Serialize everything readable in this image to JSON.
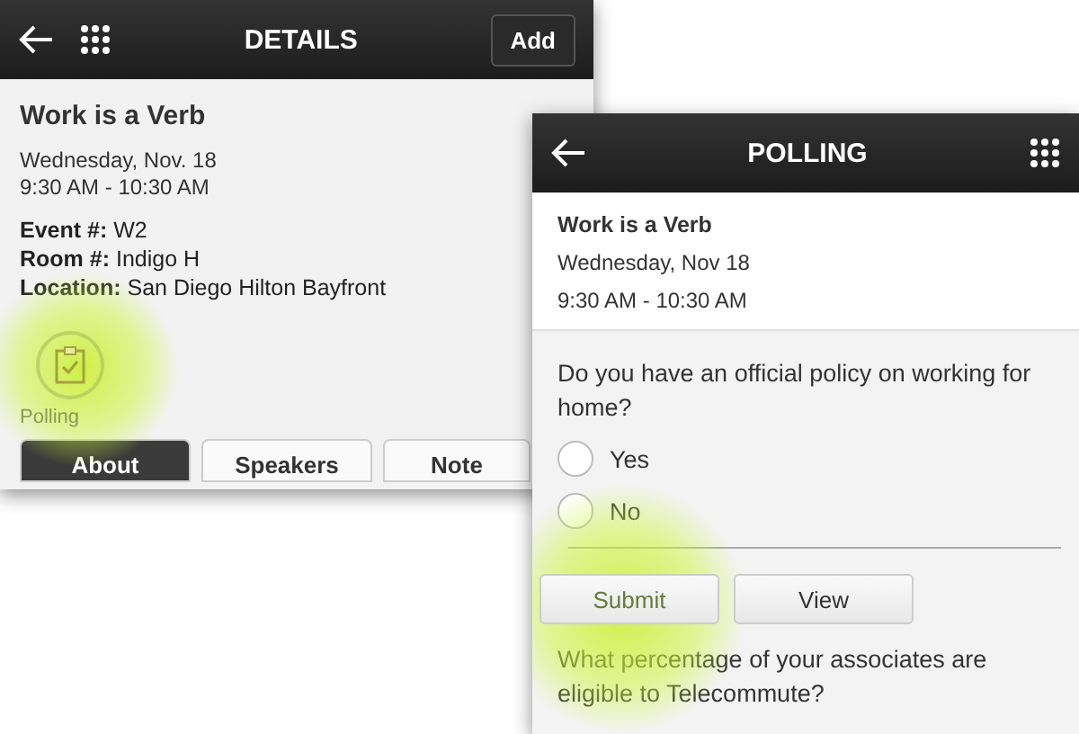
{
  "details_screen": {
    "title": "DETAILS",
    "add_button": "Add",
    "session_title": "Work is a Verb",
    "date": "Wednesday, Nov. 18",
    "time": "9:30 AM - 10:30 AM",
    "fields": [
      {
        "label": "Event #:",
        "value": "W2"
      },
      {
        "label": "Room #:",
        "value": "Indigo H"
      },
      {
        "label": "Location:",
        "value": "San Diego Hilton Bayfront"
      }
    ],
    "polling_label": "Polling",
    "tabs": [
      {
        "label": "About",
        "selected": true
      },
      {
        "label": "Speakers",
        "selected": false
      },
      {
        "label": "Note",
        "selected": false
      }
    ]
  },
  "polling_screen": {
    "title": "POLLING",
    "session_title": "Work is a Verb",
    "date": "Wednesday, Nov 18",
    "time": "9:30 AM - 10:30 AM",
    "question": "Do you have an official policy on working for home?",
    "options": [
      {
        "label": "Yes",
        "selected": false
      },
      {
        "label": "No",
        "selected": false
      }
    ],
    "buttons": [
      "Submit",
      "View"
    ],
    "next_question": "What percentage of your associates are eligible to Telecommute?"
  }
}
